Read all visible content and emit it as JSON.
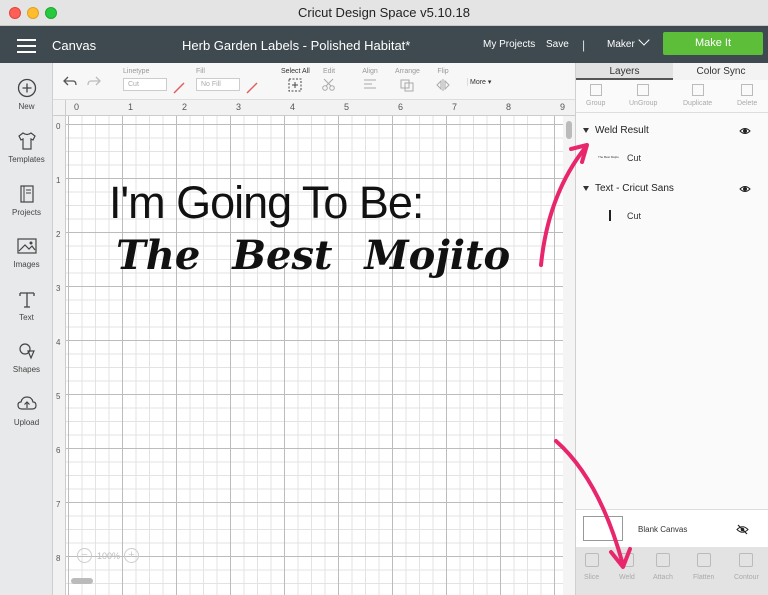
{
  "window": {
    "title": "Cricut Design Space  v5.10.18"
  },
  "header": {
    "section": "Canvas",
    "project_title": "Herb Garden Labels - Polished Habitat*",
    "my_projects": "My Projects",
    "save": "Save",
    "separator": "|",
    "machine": "Maker",
    "make_it": "Make It",
    "accent": "#5dbe3a"
  },
  "sidebar": {
    "items": [
      {
        "label": "New",
        "icon": "plus-circle-icon"
      },
      {
        "label": "Templates",
        "icon": "tshirt-icon"
      },
      {
        "label": "Projects",
        "icon": "book-icon"
      },
      {
        "label": "Images",
        "icon": "image-icon"
      },
      {
        "label": "Text",
        "icon": "text-t-icon"
      },
      {
        "label": "Shapes",
        "icon": "shapes-icon"
      },
      {
        "label": "Upload",
        "icon": "cloud-upload-icon"
      }
    ]
  },
  "toolbar": {
    "linetype_label": "Linetype",
    "linetype_value": "Cut",
    "fill_label": "Fill",
    "fill_value": "No Fill",
    "select_all": "Select All",
    "edit": "Edit",
    "align": "Align",
    "arrange": "Arrange",
    "flip": "Flip",
    "more": "More"
  },
  "ruler": {
    "top": [
      "0",
      "1",
      "2",
      "3",
      "4",
      "5",
      "6",
      "7",
      "8",
      "9"
    ],
    "left": [
      "0",
      "1",
      "2",
      "3",
      "4",
      "5",
      "6",
      "7",
      "8"
    ]
  },
  "canvas": {
    "line1": "I'm Going To Be:",
    "line2": "The  Best  Mojito",
    "zoom": "100%",
    "zoom_minus": "−",
    "zoom_plus": "+"
  },
  "panel": {
    "tabs": [
      "Layers",
      "Color Sync"
    ],
    "tools": [
      "Group",
      "UnGroup",
      "Duplicate",
      "Delete"
    ],
    "layers": [
      {
        "name": "Weld Result",
        "sub": "Cut",
        "thumb_text": "The Best Mojito"
      },
      {
        "name": "Text - Cricut Sans",
        "sub": "Cut"
      }
    ],
    "blank_canvas": "Blank Canvas",
    "bottom_tools": [
      "Slice",
      "Weld",
      "Attach",
      "Flatten",
      "Contour"
    ]
  },
  "annotations": {
    "arrow_color": "#e8266c"
  }
}
